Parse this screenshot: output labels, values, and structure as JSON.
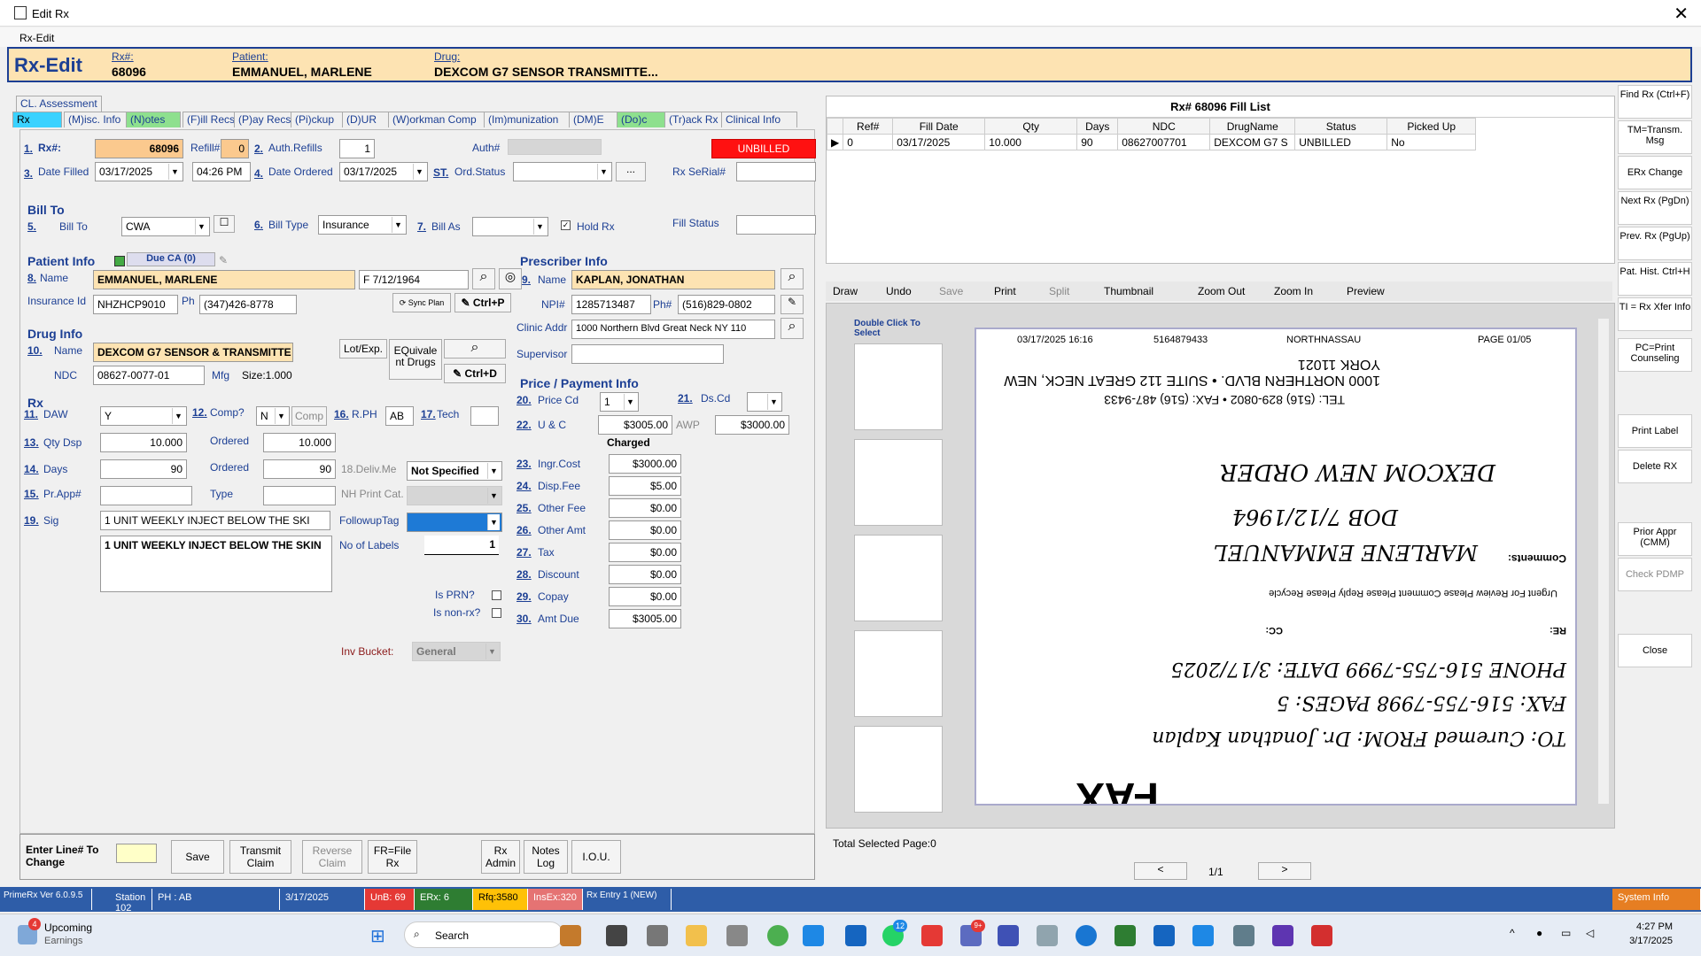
{
  "window": {
    "title": "Edit Rx",
    "close": "✕",
    "subtitle": "Rx-Edit"
  },
  "header": {
    "title": "Rx-Edit",
    "rx_label": "Rx#:",
    "rx_value": "68096",
    "patient_label": "Patient:",
    "patient_value": "EMMANUEL, MARLENE",
    "drug_label": "Drug:",
    "drug_value": "DEXCOM G7 SENSOR TRANSMITTE..."
  },
  "tabs": {
    "top": "CL. Assessment",
    "items": [
      "Rx",
      "(M)isc. Info",
      "(N)otes",
      "(F)ill Recs",
      "(P)ay Recs",
      "(Pi)ckup",
      "(D)UR",
      "(W)orkman Comp",
      "(Im)munization",
      "(DM)E",
      "(Do)c",
      "(Tr)ack Rx",
      "Clinical Info"
    ]
  },
  "rx": {
    "n1": "1.",
    "rx_label": "Rx#:",
    "rx_value": "68096",
    "refill_label": "Refill#",
    "refill_value": "0",
    "n2": "2.",
    "auth_label": "Auth.Refills",
    "auth_value": "1",
    "authno_label": "Auth#",
    "unbilled": "UNBILLED",
    "n3": "3.",
    "date_filled_label": "Date Filled",
    "date_filled": "03/17/2025",
    "time": "04:26 PM",
    "n4": "4.",
    "date_ordered_label": "Date Ordered",
    "date_ordered": "03/17/2025",
    "st_label": "ST.",
    "ord_status_label": "Ord.Status",
    "ellipsis": "...",
    "serial_label": "Rx SeRial#"
  },
  "bill": {
    "title": "Bill To",
    "n5": "5.",
    "bill_to_label": "Bill To",
    "bill_to": "CWA",
    "n6": "6.",
    "bill_type_label": "Bill Type",
    "bill_type": "Insurance",
    "n7": "7.",
    "bill_as_label": "Bill As",
    "hold_rx": "Hold Rx",
    "fill_status": "Fill Status"
  },
  "patient": {
    "title": "Patient Info",
    "due": "Due CA (0)",
    "n8": "8.",
    "name_label": "Name",
    "name": "EMMANUEL, MARLENE",
    "gender_dob": "F  7/12/1964",
    "ins_label": "Insurance Id",
    "ins_id": "NHZHCP9010",
    "ph_label": "Ph",
    "phone": "(347)426-8778",
    "sync": "Sync Plan",
    "ctrlp": "Ctrl+P"
  },
  "prescriber": {
    "title": "Prescriber Info",
    "n9": "9.",
    "name_label": "Name",
    "name": "KAPLAN, JONATHAN",
    "npi_label": "NPI#",
    "npi": "1285713487",
    "ph_label": "Ph#",
    "phone": "(516)829-0802",
    "addr_label": "Clinic Addr",
    "addr": "1000 Northern Blvd  Great Neck NY 110",
    "sup_label": "Supervisor"
  },
  "drug": {
    "title": "Drug Info",
    "n10": "10.",
    "name_label": "Name",
    "name": "DEXCOM G7 SENSOR & TRANSMITTE",
    "lot": "Lot/Exp.",
    "equiv": "EQuivale nt Drugs",
    "ndc_label": "NDC",
    "ndc": "08627-0077-01",
    "mfg_label": "Mfg",
    "size": "Size:1.000",
    "ctrld": "Ctrl+D"
  },
  "rxsec": {
    "title": "Rx",
    "n11": "11.",
    "daw_label": "DAW",
    "daw": "Y",
    "n12": "12.",
    "comp_label": "Comp?",
    "comp": "N",
    "comp_btn": "Comp",
    "n16": "16.",
    "rph_label": "R.PH",
    "rph": "AB",
    "n17": "17.",
    "tech_label": "Tech",
    "n13": "13.",
    "qty_label": "Qty Dsp",
    "qty": "10.000",
    "ordered_label": "Ordered",
    "qty_ordered": "10.000",
    "n14": "14.",
    "days_label": "Days",
    "days": "90",
    "days_ordered": "90",
    "deliv_label": "18.Deliv.Me",
    "deliv": "Not Specified",
    "n15": "15.",
    "prapp_label": "Pr.App#",
    "type_label": "Type",
    "nh_label": "NH Print Cat.",
    "n19": "19.",
    "sig_label": "Sig",
    "sig": "1 UNIT WEEKLY INJECT BELOW THE SKI",
    "followup_label": "FollowupTag",
    "labels_label": "No of Labels",
    "labels": "1",
    "sig_text": "1 UNIT WEEKLY INJECT BELOW THE SKIN",
    "prn_label": "Is PRN?",
    "nonrx_label": "Is non-rx?",
    "inv_label": "Inv Bucket:",
    "inv": "General"
  },
  "price": {
    "title": "Price / Payment Info",
    "n20": "20.",
    "price_cd_label": "Price Cd",
    "price_cd": "1",
    "n21": "21.",
    "ds_label": "Ds.Cd",
    "n22": "22.",
    "uc_label": "U & C",
    "uc": "$3005.00",
    "awp_label": "AWP",
    "awp": "$3000.00",
    "charged": "Charged",
    "rows": [
      {
        "n": "23.",
        "label": "Ingr.Cost",
        "value": "$3000.00"
      },
      {
        "n": "24.",
        "label": "Disp.Fee",
        "value": "$5.00"
      },
      {
        "n": "25.",
        "label": "Other Fee",
        "value": "$0.00"
      },
      {
        "n": "26.",
        "label": "Other Amt",
        "value": "$0.00"
      },
      {
        "n": "27.",
        "label": "Tax",
        "value": "$0.00"
      },
      {
        "n": "28.",
        "label": "Discount",
        "value": "$0.00"
      },
      {
        "n": "29.",
        "label": "Copay",
        "value": "$0.00"
      },
      {
        "n": "30.",
        "label": "Amt Due",
        "value": "$3005.00"
      }
    ]
  },
  "fill_list": {
    "title": "Rx# 68096 Fill List",
    "columns": [
      "Ref#",
      "Fill Date",
      "Qty",
      "Days",
      "NDC",
      "DrugName",
      "Status",
      "Picked Up"
    ],
    "row": [
      "0",
      "03/17/2025",
      "10.000",
      "90",
      "08627007701",
      "DEXCOM G7 S",
      "UNBILLED",
      "No"
    ]
  },
  "image_toolbar": [
    "Draw",
    "Undo",
    "Save",
    "Print",
    "Split",
    "Thumbnail",
    "Zoom Out",
    "Zoom In",
    "Preview"
  ],
  "viewer": {
    "dbl": "Double  Click To Select",
    "fax_header": [
      "03/17/2025  16:16",
      "5164879433",
      "NORTHNASSAU",
      "PAGE  01/05"
    ],
    "addr": "1000 NORTHERN BLVD. • SUITE 112  GREAT NECK, NEW YORK 11021",
    "tel": "TEL: (516) 829-0802 • FAX: (516) 487-9433",
    "hand1": "DEXCOM NEW ORDER",
    "hand2": "DOB 7/12/1964",
    "hand3": "MARLENE EMMANUEL",
    "comments": "Comments:",
    "checks": "Urgent   For Review   Please Comment   Please Reply   Please Recycle",
    "re": "RE:",
    "cc": "CC:",
    "phone": "PHONE  516-755-7999   DATE:  3/17/2025",
    "fax": "FAX:  516-755-7998   PAGES:  5",
    "to": "TO:  Curemed   FROM:  Dr. Jonathan Kaplan",
    "fax_big": "FAX",
    "total": "Total Selected Page:0",
    "page": "1/1",
    "prev": "<",
    "next": ">"
  },
  "sidebar": [
    "Find Rx (Ctrl+F)",
    "TM=Transm. Msg",
    "ERx Change",
    "Next Rx (PgDn)",
    "Prev. Rx (PgUp)",
    "Pat. Hist. Ctrl+H",
    "TI = Rx Xfer Info",
    "PC=Print Counseling",
    "Print Label",
    "Delete RX",
    "Prior Appr (CMM)",
    "Check PDMP",
    "Close"
  ],
  "bottom": {
    "enter_line": "Enter Line# To Change",
    "save": "Save",
    "transmit": "Transmit Claim",
    "reverse": "Reverse Claim",
    "frfile": "FR=File Rx",
    "rxadmin": "Rx Admin",
    "notes": "Notes Log",
    "iou": "I.O.U."
  },
  "status": {
    "ver": "PrimeRx Ver 6.0.9.5",
    "station": "Station 102",
    "ph": "PH : AB",
    "date": "3/17/2025",
    "unb": "UnB: 69",
    "erx": "ERx: 6",
    "rfq": "Rfq:3580",
    "insex": "InsEx:320",
    "rxentry": "Rx Entry 1 (NEW)",
    "sysinfo": "System Info"
  },
  "taskbar": {
    "weather_title": "Upcoming",
    "weather_sub": "Earnings",
    "badge": "4",
    "search": "Search",
    "time": "4:27 PM",
    "date": "3/17/2025",
    "badge12": "12",
    "badge9": "9+"
  }
}
